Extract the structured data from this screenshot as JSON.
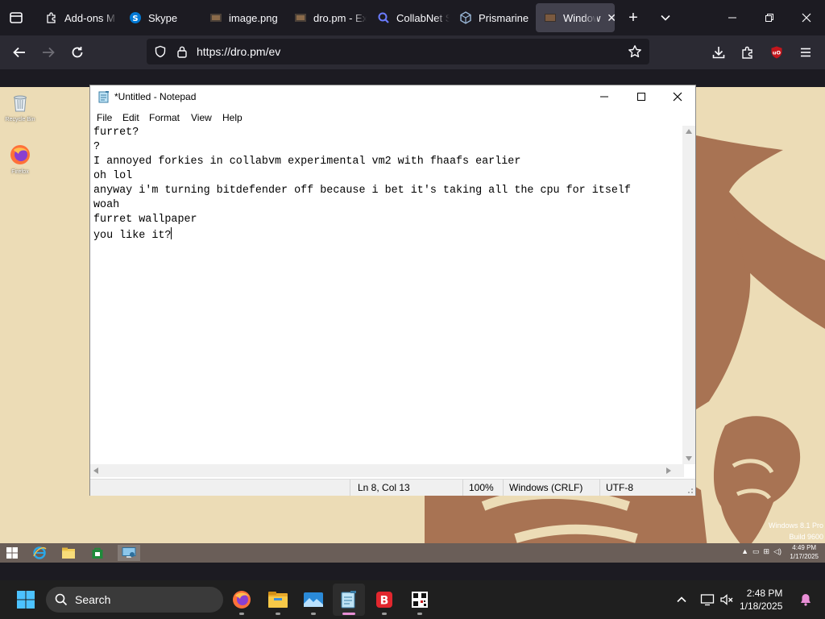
{
  "browser": {
    "tabs": [
      {
        "title": "Add-ons M",
        "icon": "puzzle-icon"
      },
      {
        "title": "Skype",
        "icon": "skype-icon"
      },
      {
        "title": "image.png",
        "icon": "image-icon"
      },
      {
        "title": "dro.pm - Ex",
        "icon": "image-icon"
      },
      {
        "title": "CollabNet S",
        "icon": "search-icon"
      },
      {
        "title": "Prismarine",
        "icon": "hexagon-icon"
      },
      {
        "title": "Window",
        "icon": "vm-screen-icon",
        "active": true
      }
    ],
    "url": "https://dro.pm/ev"
  },
  "notepad": {
    "title": "*Untitled - Notepad",
    "menu": [
      "File",
      "Edit",
      "Format",
      "View",
      "Help"
    ],
    "lines": [
      "furret?",
      "?",
      "I annoyed forkies in collabvm experimental vm2 with fhaafs earlier",
      "oh lol",
      "anyway i'm turning bitdefender off because i bet it's taking all the cpu for itself",
      "woah",
      "furret wallpaper",
      "you like it?"
    ],
    "status": {
      "position": "Ln 8, Col 13",
      "zoom": "100%",
      "line_endings": "Windows (CRLF)",
      "encoding": "UTF-8"
    }
  },
  "vm": {
    "desktop_icons": [
      "Recycle Bin",
      "Firefox"
    ],
    "watermark": [
      "Windows 8.1 Pro",
      "Build 9600"
    ],
    "clock": {
      "time": "4:49 PM",
      "date": "1/17/2025"
    }
  },
  "host_taskbar": {
    "search_label": "Search",
    "clock": {
      "time": "2:48 PM",
      "date": "1/18/2025"
    }
  },
  "colors": {
    "wallpaper": "#ecdcb6",
    "furret_brown": "#a87353",
    "notification_accent": "#e98fd6"
  }
}
